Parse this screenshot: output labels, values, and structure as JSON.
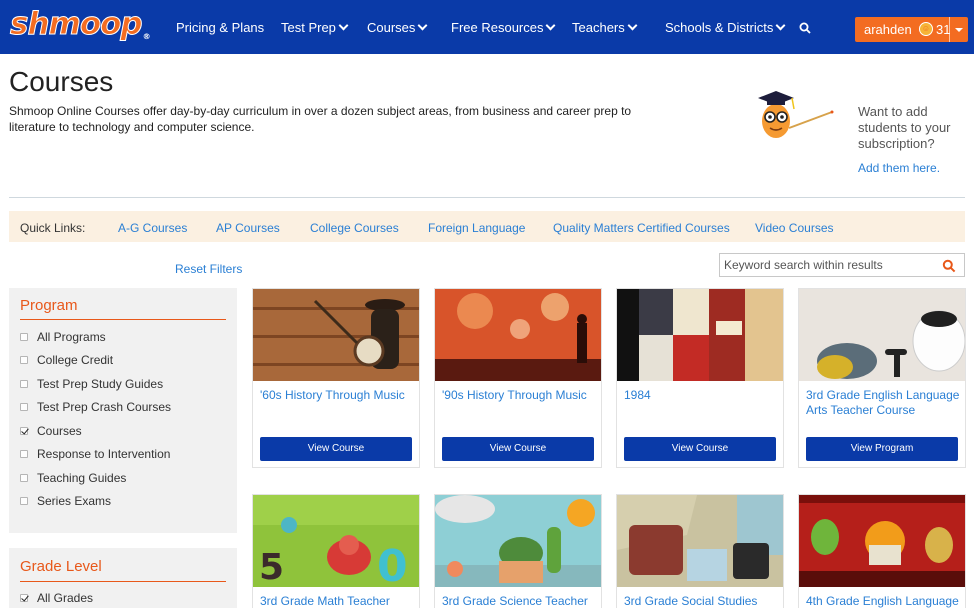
{
  "nav": {
    "logo": "shmoop",
    "logo_mark": "®",
    "items": [
      "Pricing & Plans",
      "Test Prep",
      "Courses",
      "Free Resources",
      "Teachers",
      "Schools & Districts"
    ],
    "user": {
      "name": "arahden",
      "points": "31"
    }
  },
  "header": {
    "title": "Courses",
    "description": "Shmoop Online Courses offer day-by-day curriculum in over a dozen subject areas, from business and career prep to literature to technology and computer science.",
    "promo_text": "Want to add students to your subscription?",
    "promo_link": "Add them here."
  },
  "quick_links": {
    "label": "Quick Links:",
    "links": [
      "A-G Courses",
      "AP Courses",
      "College Courses",
      "Foreign Language",
      "Quality Matters Certified Courses",
      "Video Courses"
    ]
  },
  "filters": {
    "reset_label": "Reset Filters",
    "search_placeholder": "Keyword search within results",
    "program": {
      "title": "Program",
      "options": [
        {
          "label": "All Programs",
          "checked": false
        },
        {
          "label": "College Credit",
          "checked": false
        },
        {
          "label": "Test Prep Study Guides",
          "checked": false
        },
        {
          "label": "Test Prep Crash Courses",
          "checked": false
        },
        {
          "label": "Courses",
          "checked": true
        },
        {
          "label": "Response to Intervention",
          "checked": false
        },
        {
          "label": "Teaching Guides",
          "checked": false
        },
        {
          "label": "Series Exams",
          "checked": false
        }
      ]
    },
    "grade": {
      "title": "Grade Level",
      "options": [
        {
          "label": "All Grades",
          "checked": true
        }
      ]
    }
  },
  "courses": [
    {
      "title": "'60s History Through Music",
      "button": "View Course"
    },
    {
      "title": "'90s History Through Music",
      "button": "View Course"
    },
    {
      "title": "1984",
      "button": "View Course"
    },
    {
      "title": "3rd Grade English Language Arts Teacher Course",
      "button": "View Program"
    },
    {
      "title": "3rd Grade Math Teacher",
      "button": ""
    },
    {
      "title": "3rd Grade Science Teacher",
      "button": ""
    },
    {
      "title": "3rd Grade Social Studies",
      "button": ""
    },
    {
      "title": "4th Grade English Language",
      "button": ""
    }
  ],
  "colors": {
    "nav_bg": "#0a3aa8",
    "accent": "#f36c21",
    "link": "#2a7fd4",
    "button": "#0a3aa8",
    "section_title": "#e8581a"
  }
}
